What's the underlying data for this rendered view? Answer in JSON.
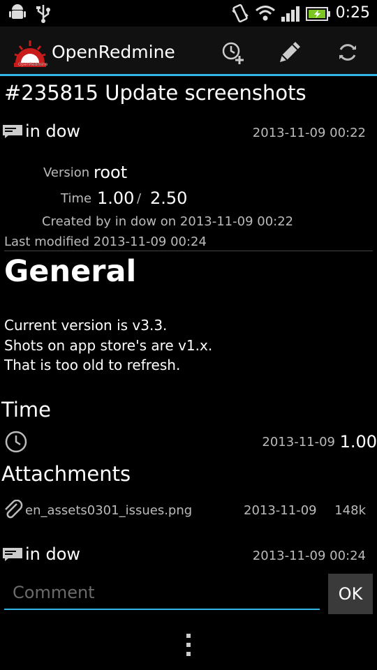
{
  "status_bar": {
    "time": "0:25",
    "icons": [
      "android-debug-icon",
      "usb-icon",
      "vibrate-icon",
      "wifi-icon",
      "signal-icon",
      "battery-charging-icon"
    ]
  },
  "action_bar": {
    "app_name": "OpenRedmine",
    "logo_caption": "OpenRedmine",
    "actions": [
      "add-time-entry-icon",
      "edit-pencil-icon",
      "refresh-icon"
    ],
    "accent_color": "#33b5e5"
  },
  "issue": {
    "title": "#235815 Update screenshots",
    "author": "in dow",
    "author_date": "2013-11-09 00:22",
    "version_label": "Version",
    "version_value": "root",
    "time_label": "Time",
    "time_spent": "1.00",
    "time_separator": "/",
    "time_estimated": "2.50",
    "created_line": "Created by in dow on 2013-11-09 00:22",
    "modified_line": "Last modified 2013-11-09 00:24"
  },
  "description": {
    "heading": "General",
    "lines": [
      "Current version is v3.3.",
      "Shots on app store's are v1.x.",
      "That is too old to refresh."
    ]
  },
  "time_section": {
    "heading": "Time",
    "entry_date": "2013-11-09",
    "entry_hours": "1.00"
  },
  "attachments_section": {
    "heading": "Attachments",
    "filename": "en_assets0301_issues.png",
    "date": "2013-11-09",
    "size": "148k"
  },
  "journal": {
    "author": "in dow",
    "date": "2013-11-09 00:24"
  },
  "comment": {
    "placeholder": "Comment",
    "value": "",
    "ok_label": "OK"
  },
  "overflow_menu_icon": "overflow-menu-icon"
}
